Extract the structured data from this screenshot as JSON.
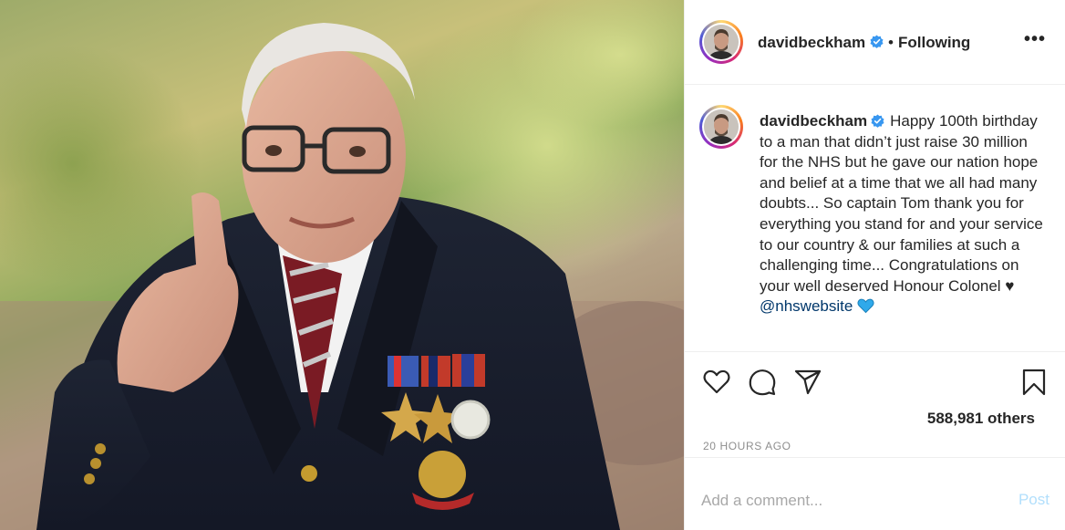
{
  "post": {
    "photo_alt": "",
    "author": {
      "username": "davidbeckham",
      "verified": true,
      "follow_status": "Following"
    },
    "caption": {
      "username": "davidbeckham",
      "text": "Happy 100th birthday to a man that didn’t just raise 30 million for the NHS but he gave our nation hope and belief at a time that we all had many doubts... So captain Tom thank you for everything you stand for and your service to our country & our families at such a challenging time... Congratulations on your well deserved Honour Colonel ♥",
      "mention": "@nhswebsite",
      "emoji": "blue-heart"
    },
    "likes": "588,981 others",
    "timestamp": "20 HOURS AGO",
    "comment": {
      "placeholder": "Add a comment...",
      "post_label": "Post"
    },
    "icons": {
      "like": "heart-icon",
      "comment": "comment-icon",
      "share": "share-icon",
      "save": "bookmark-icon",
      "more": "more-options-icon",
      "verified": "verified-badge-icon"
    },
    "colors": {
      "verified": "#3897f0",
      "post_button": "#b2dffc",
      "muted_text": "#8e8e8e",
      "mention": "#00376b"
    }
  }
}
